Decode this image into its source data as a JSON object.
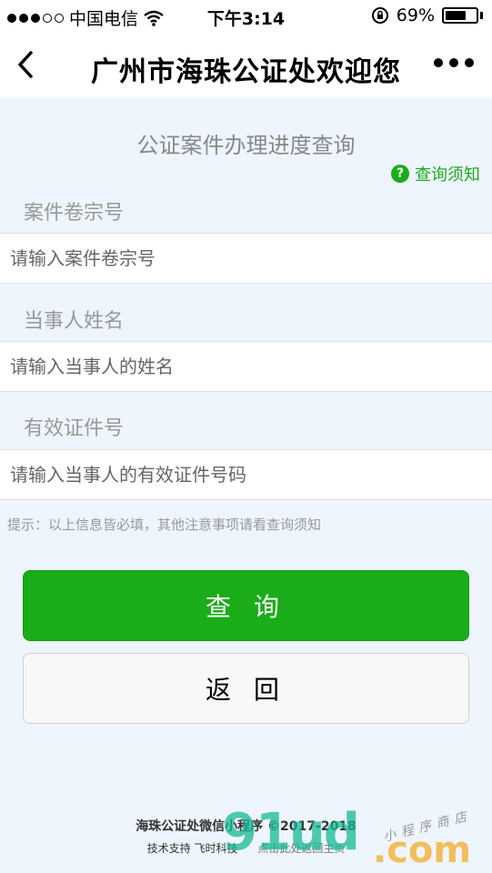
{
  "status": {
    "carrier": "中国电信",
    "time": "下午3:14",
    "battery_percent": "69%",
    "battery_level": 0.69
  },
  "nav": {
    "title": "广州市海珠公证处欢迎您"
  },
  "form": {
    "heading": "公证案件办理进度查询",
    "notice_link": "查询须知",
    "fields": [
      {
        "label": "案件卷宗号",
        "placeholder": "请输入案件卷宗号"
      },
      {
        "label": "当事人姓名",
        "placeholder": "请输入当事人的姓名"
      },
      {
        "label": "有效证件号",
        "placeholder": "请输入当事人的有效证件号码"
      }
    ],
    "hint": "提示：以上信息皆必填，其他注意事项请看查询须知"
  },
  "buttons": {
    "query": "查 询",
    "back": "返 回"
  },
  "footer": {
    "line1": "海珠公证处微信小程序 ©2017-2018",
    "support": "技术支持 飞时科技",
    "home_link": "点击此处返回主页"
  },
  "watermark": {
    "main": "91ud",
    "domain": ".com",
    "tagline": "小程序商店"
  },
  "colors": {
    "accent": "#1aad19",
    "background": "#eef5fc"
  }
}
